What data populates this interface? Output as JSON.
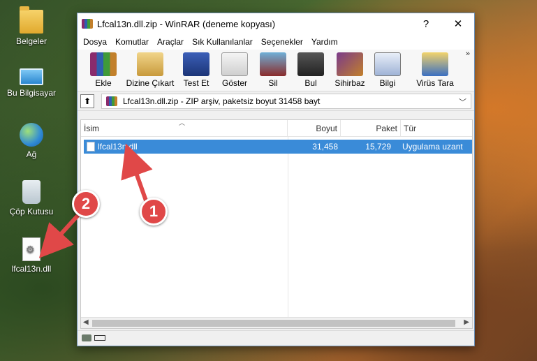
{
  "desktop": {
    "icons": [
      {
        "label": "Belgeler",
        "icon": "folder-icon"
      },
      {
        "label": "Bu Bilgisayar",
        "icon": "computer-icon"
      },
      {
        "label": "Ağ",
        "icon": "network-icon"
      },
      {
        "label": "Çöp Kutusu",
        "icon": "recycle-bin-icon"
      },
      {
        "label": "lfcal13n.dll",
        "icon": "dll-file-icon"
      }
    ]
  },
  "window": {
    "title": "Lfcal13n.dll.zip - WinRAR (deneme kopyası)",
    "help": "?",
    "close": "✕",
    "menu": [
      "Dosya",
      "Komutlar",
      "Araçlar",
      "Sık Kullanılanlar",
      "Seçenekler",
      "Yardım"
    ],
    "toolbar": [
      {
        "label": "Ekle",
        "icon": "add-archive-icon"
      },
      {
        "label": "Dizine Çıkart",
        "icon": "extract-to-icon"
      },
      {
        "label": "Test Et",
        "icon": "test-icon"
      },
      {
        "label": "Göster",
        "icon": "view-icon"
      },
      {
        "label": "Sil",
        "icon": "delete-icon"
      },
      {
        "label": "Bul",
        "icon": "find-icon"
      },
      {
        "label": "Sihirbaz",
        "icon": "wizard-icon"
      },
      {
        "label": "Bilgi",
        "icon": "info-icon"
      },
      {
        "label": "Virüs Tara",
        "icon": "virus-scan-icon"
      }
    ],
    "more": "»",
    "address": "Lfcal13n.dll.zip - ZIP arşiv, paketsiz boyut 31458 bayt",
    "columns": {
      "name": "İsim",
      "size": "Boyut",
      "packed": "Paket",
      "type": "Tür"
    },
    "files": [
      {
        "name": "lfcal13n.dll",
        "size": "31,458",
        "packed": "15,729",
        "type": "Uygulama uzant"
      }
    ]
  },
  "annotations": {
    "badge1": "1",
    "badge2": "2"
  },
  "colors": {
    "selection": "#3a8bd8",
    "badge": "#e04848"
  }
}
